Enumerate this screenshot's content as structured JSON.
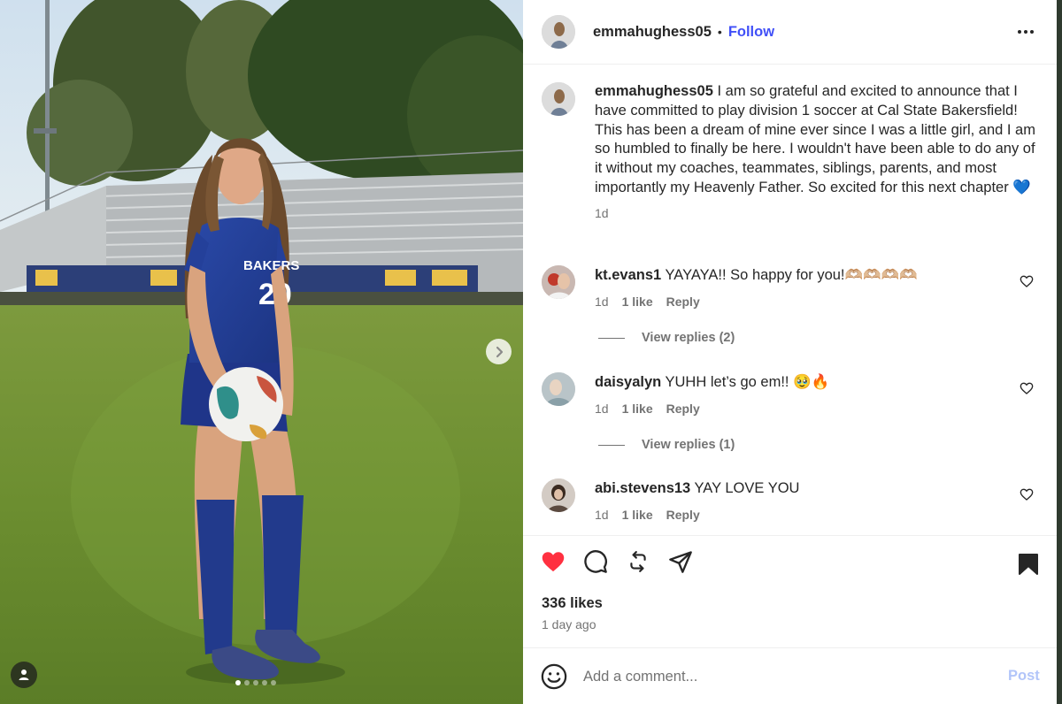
{
  "post": {
    "author": "emmahughess05",
    "follow_label": "Follow",
    "separator": "•",
    "caption_text": "I am so grateful and excited to announce that I have committed to play division 1 soccer at Cal State Bakersfield! This has been a dream of mine ever since I was a little girl, and I am so humbled to finally be here. I wouldn't have been able to do any of it without my coaches, teammates, siblings, parents, and most importantly my Heavenly Father. So excited for this next chapter 💙",
    "caption_time": "1d",
    "jersey_number": "20",
    "jersey_text": "BAKERS",
    "carousel_count": 5,
    "carousel_active": 0
  },
  "comments": [
    {
      "user": "kt.evans1",
      "text": "YAYAYA!! So happy for you!🫶🏼🫶🏼🫶🏼🫶🏼",
      "time": "1d",
      "likes": "1 like",
      "reply": "Reply",
      "view_replies": "View replies (2)"
    },
    {
      "user": "daisyalyn",
      "text": "YUHH let’s go em!! 🥹🔥",
      "time": "1d",
      "likes": "1 like",
      "reply": "Reply",
      "view_replies": "View replies (1)"
    },
    {
      "user": "abi.stevens13",
      "text": "YAY LOVE YOU",
      "time": "1d",
      "likes": "1 like",
      "reply": "Reply"
    }
  ],
  "stats": {
    "likes": "336 likes",
    "posted": "1 day ago"
  },
  "composer": {
    "placeholder": "Add a comment...",
    "post_label": "Post"
  },
  "colors": {
    "accent": "#4150f7",
    "like_red": "#ff3040",
    "post_disabled": "#b2c5f9"
  },
  "icons": [
    "more-icon",
    "heart-icon",
    "comment-icon",
    "repost-icon",
    "share-icon",
    "bookmark-icon",
    "emoji-icon",
    "chevron-right-icon",
    "user-tag-icon"
  ]
}
